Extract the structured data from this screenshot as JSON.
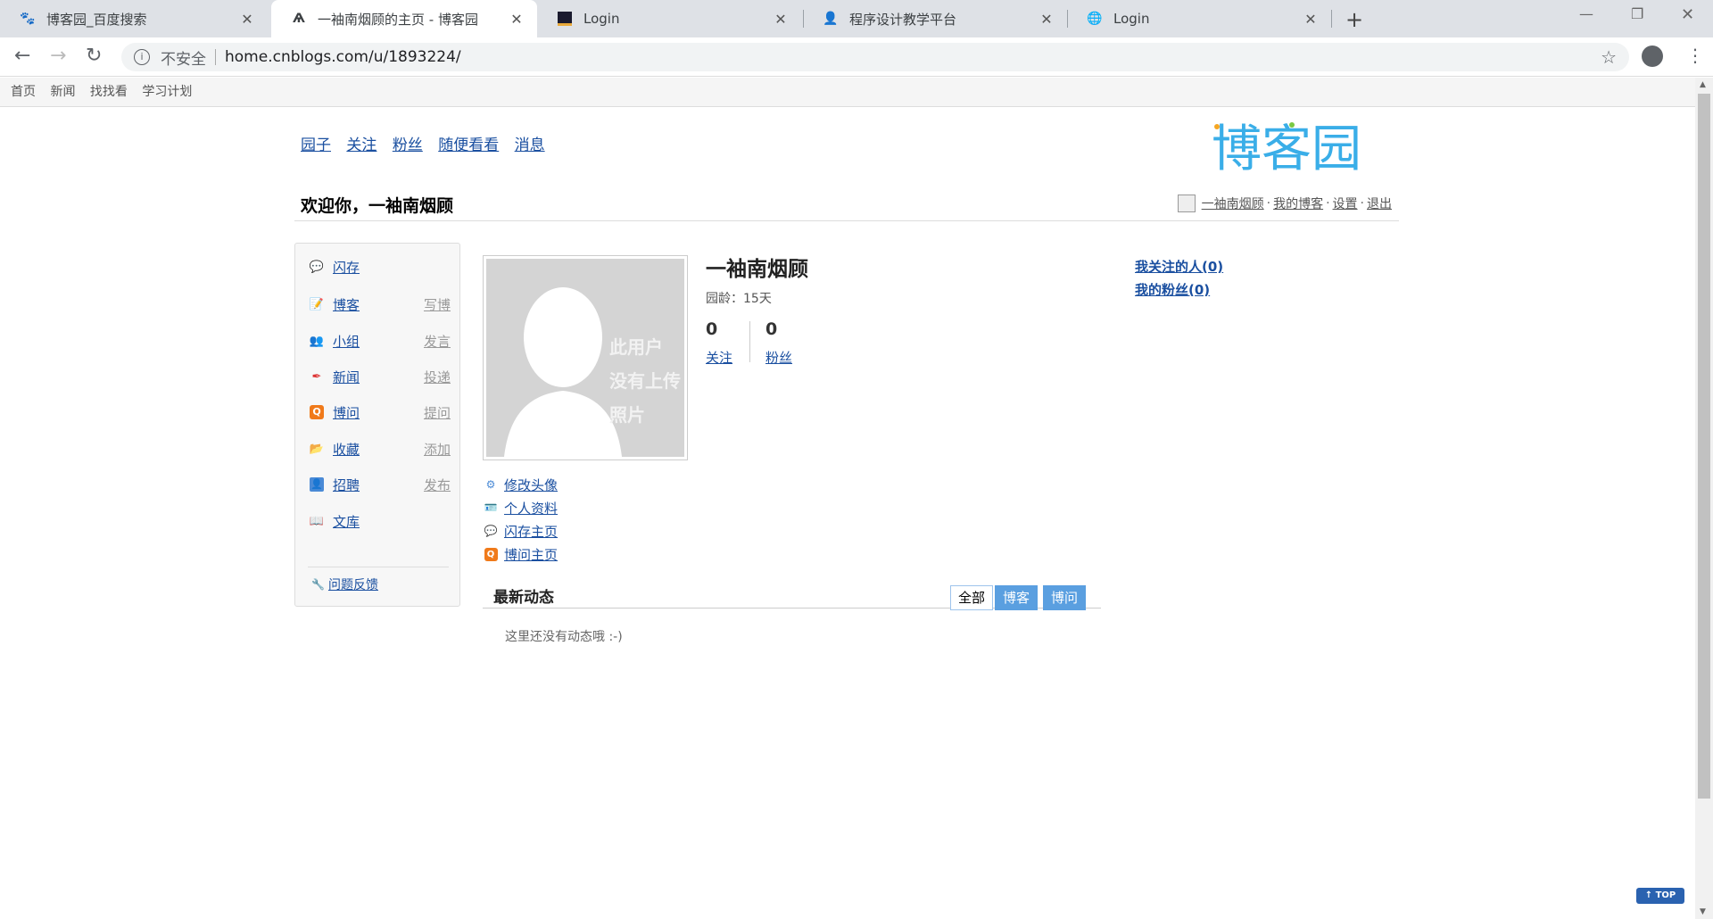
{
  "browser": {
    "tabs": [
      {
        "title": "博客园_百度搜索",
        "icon": "baidu-paw-icon"
      },
      {
        "title": "一袖南烟顾的主页 - 博客园",
        "icon": "cnblogs-icon"
      },
      {
        "title": "Login",
        "icon": "dark-square-icon"
      },
      {
        "title": "程序设计教学平台",
        "icon": "teacher-icon"
      },
      {
        "title": "Login",
        "icon": "globe-icon"
      }
    ],
    "insecure_label": "不安全",
    "url": "home.cnblogs.com/u/1893224/"
  },
  "sitebar": {
    "items": [
      "首页",
      "新闻",
      "找找看",
      "学习计划"
    ]
  },
  "topnav": {
    "items": [
      "园子",
      "关注",
      "粉丝",
      "随便看看",
      "消息"
    ]
  },
  "logo": {
    "text": "博客园",
    "colors": [
      "#3aaee8",
      "#f5a623",
      "#7ac943",
      "#3aaee8"
    ]
  },
  "welcome": "欢迎你，一袖南烟顾",
  "userlinks": {
    "name": "一袖南烟顾",
    "blog": "我的博客",
    "settings": "设置",
    "logout": "退出",
    "dot": "·"
  },
  "leftnav": {
    "items": [
      {
        "label": "闪存",
        "action": "",
        "icon": "chat-bubble-icon"
      },
      {
        "label": "博客",
        "action": "写博",
        "icon": "pencil-note-icon"
      },
      {
        "label": "小组",
        "action": "发言",
        "icon": "group-icon"
      },
      {
        "label": "新闻",
        "action": "投递",
        "icon": "news-icon"
      },
      {
        "label": "博问",
        "action": "提问",
        "icon": "q-icon"
      },
      {
        "label": "收藏",
        "action": "添加",
        "icon": "folder-icon"
      },
      {
        "label": "招聘",
        "action": "发布",
        "icon": "person-card-icon"
      },
      {
        "label": "文库",
        "action": "",
        "icon": "book-icon"
      }
    ],
    "feedback": "问题反馈"
  },
  "profile": {
    "avatar_text": "此用户\n没有上传\n照片",
    "name": "一袖南烟顾",
    "age_label": "园龄：",
    "age_value": "15天",
    "following_count": "0",
    "following_label": "关注",
    "followers_count": "0",
    "followers_label": "粉丝",
    "links": [
      {
        "label": "修改头像",
        "icon": "gear-icon"
      },
      {
        "label": "个人资料",
        "icon": "id-card-icon"
      },
      {
        "label": "闪存主页",
        "icon": "chat-bubble-icon"
      },
      {
        "label": "博问主页",
        "icon": "q-icon"
      }
    ]
  },
  "follow": {
    "following": "我关注的人(0)",
    "followers": "我的粉丝(0)"
  },
  "feed": {
    "title": "最新动态",
    "tabs": [
      "全部",
      "博客",
      "博问"
    ],
    "empty": "这里还没有动态哦 :-)"
  },
  "top_button": "↑ TOP"
}
